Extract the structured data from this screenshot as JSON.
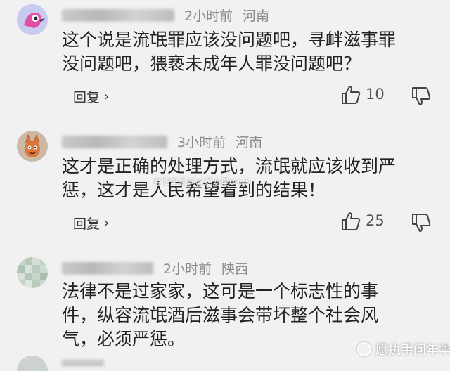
{
  "comments": [
    {
      "time": "2小时前",
      "location": "河南",
      "text_line1": "这个说是流氓罪应该没问题吧，寻衅滋事罪",
      "text_line2": "没问题吧，猥亵未成年人罪没问题吧？",
      "reply_label": "回复",
      "likes": "10",
      "avatar_icon": "pink-bird-avatar"
    },
    {
      "time": "3小时前",
      "location": "河南",
      "text_line1": "这才是正确的处理方式，流氓就应该收到严",
      "text_line2": "惩，这才是人民希望看到的结果！",
      "reply_label": "回复",
      "likes": "25",
      "avatar_icon": "cartoon-avatar"
    },
    {
      "time": "2小时前",
      "location": "陕西",
      "text_line1": "法律不是过家家，这可是一个标志性的事",
      "text_line2": "件，纵容流氓酒后滋事会带坏整个社会风",
      "text_line3": "气，必须严惩。",
      "avatar_icon": "mosaic-avatar"
    }
  ],
  "watermarks": {
    "center": "经阳尾县前@爱宠星0379",
    "corner": "愿执手问年华"
  },
  "icons": {
    "like": "thumbs-up-icon",
    "dislike": "thumbs-down-icon",
    "reply_chevron": "chevron-right-icon"
  }
}
